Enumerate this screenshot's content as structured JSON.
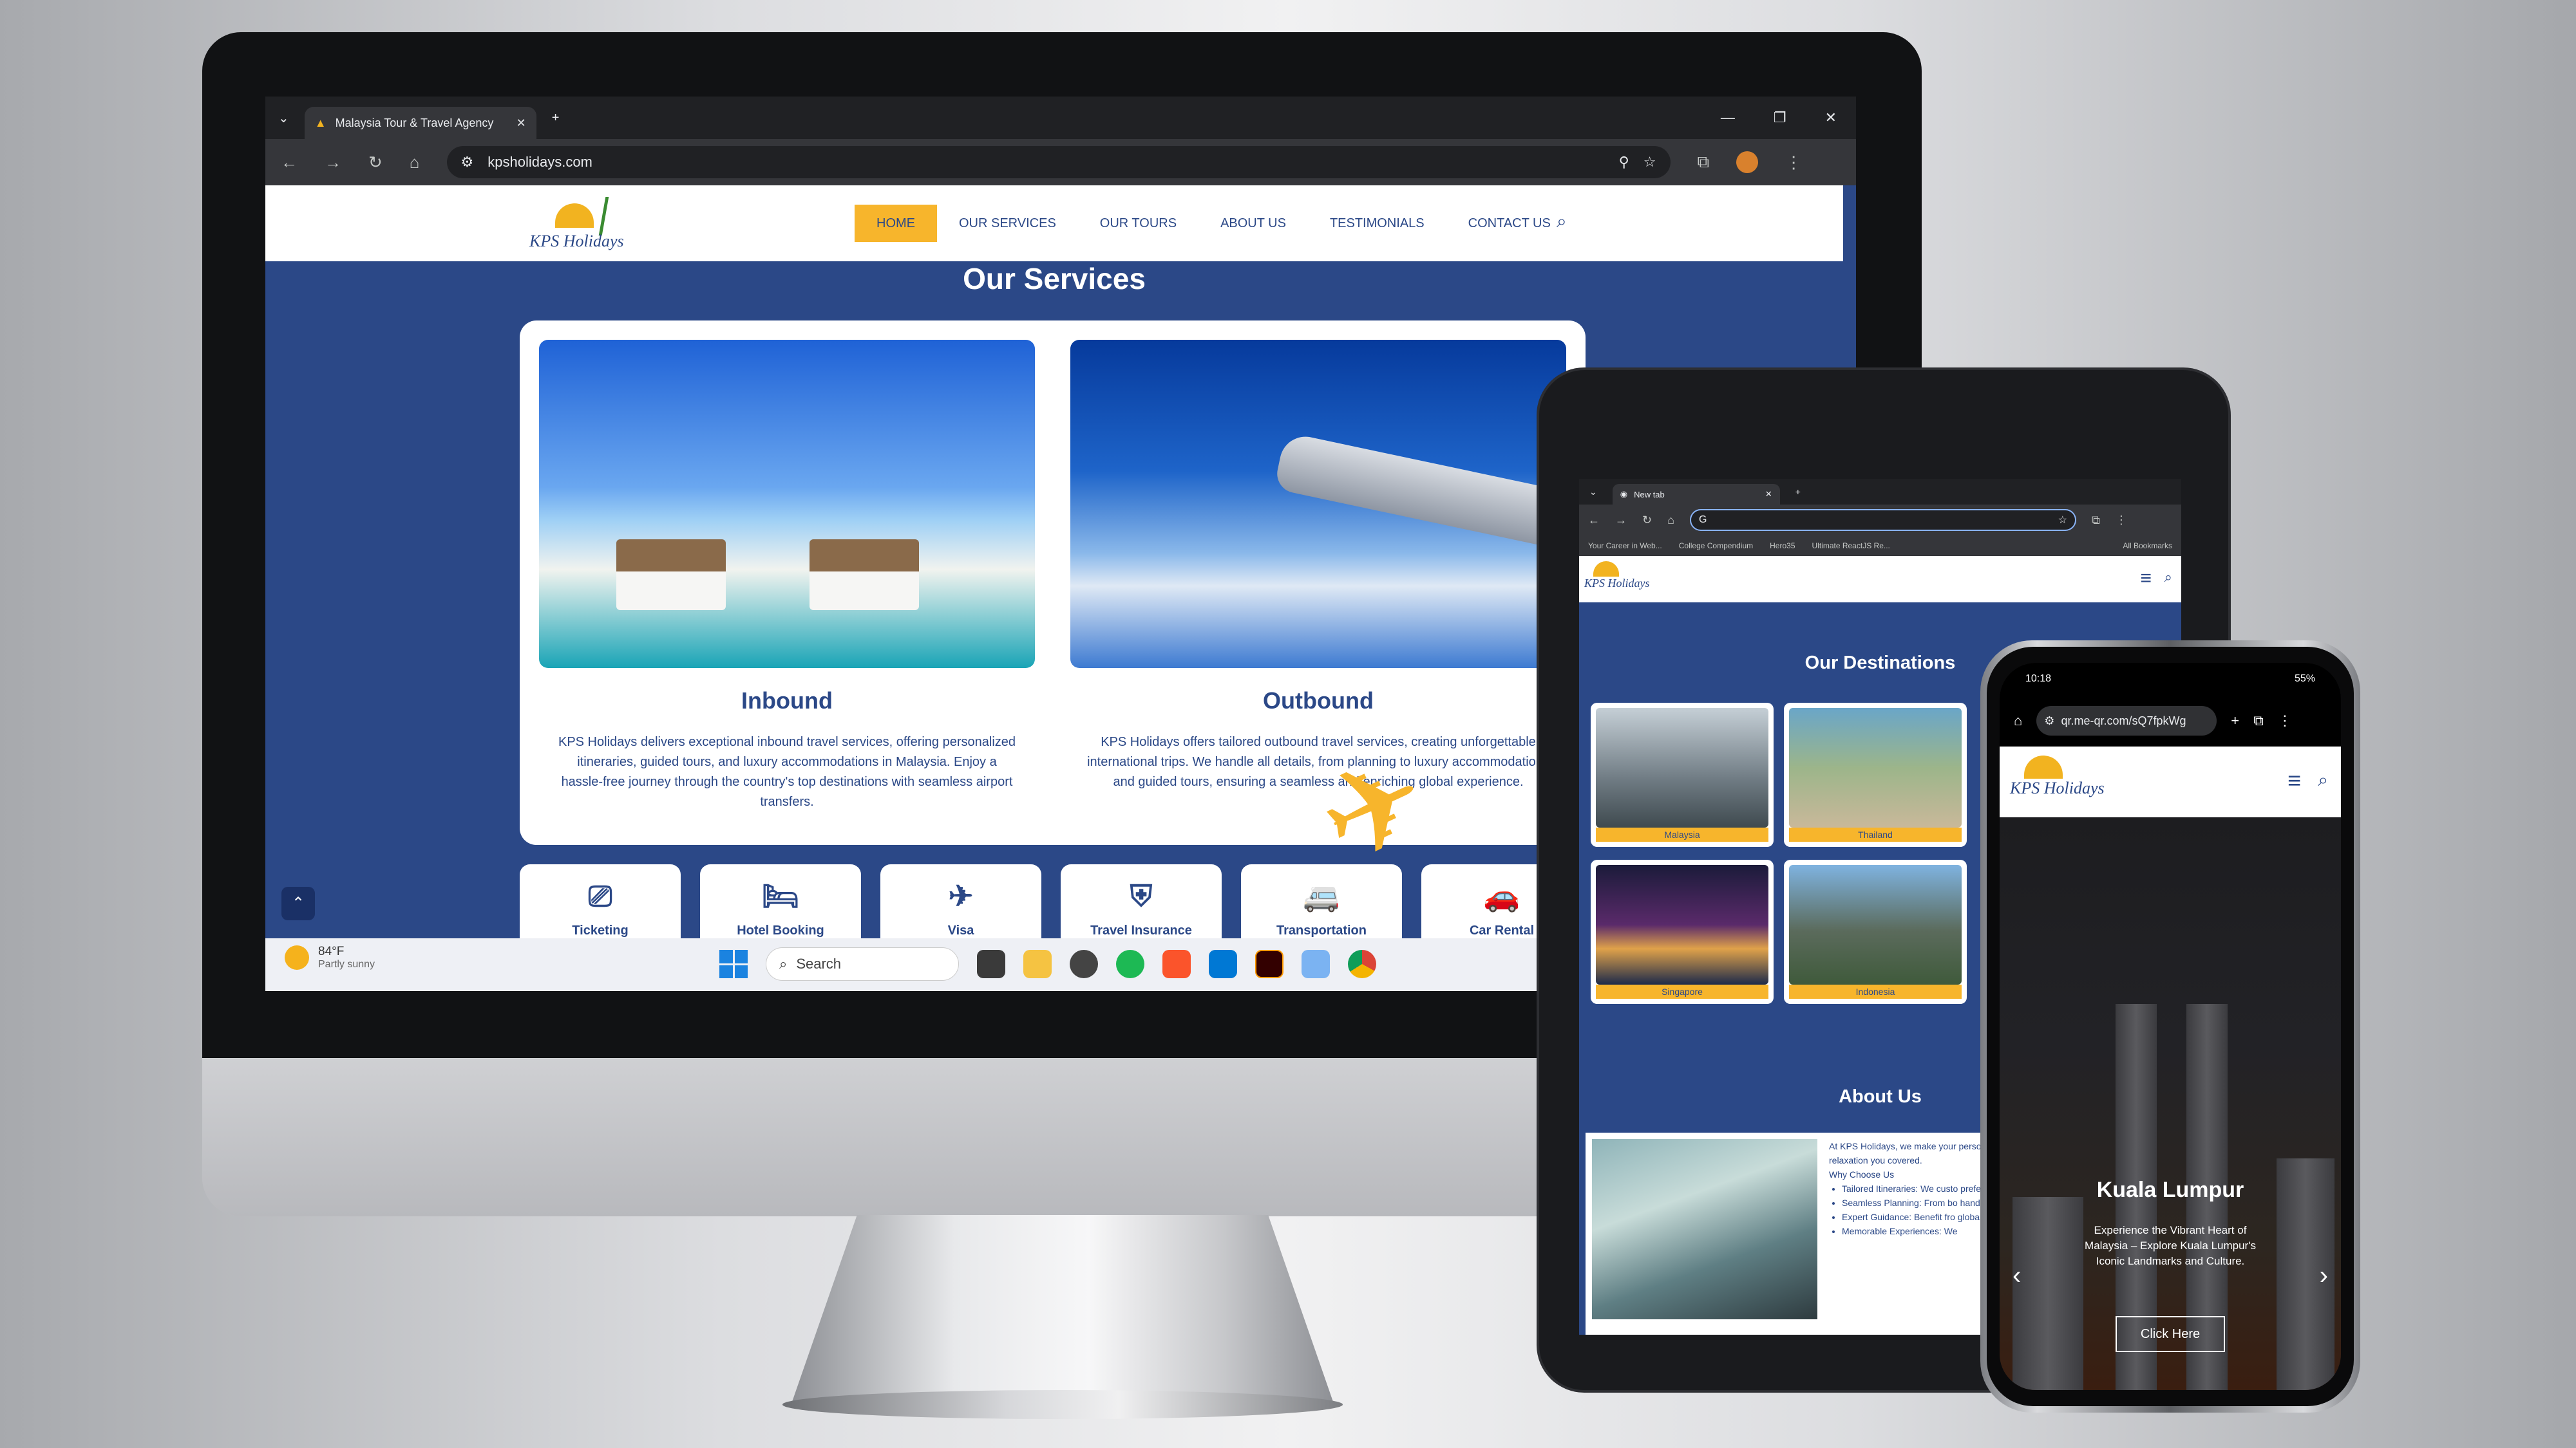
{
  "desktop": {
    "tab_title": "Malaysia Tour & Travel Agency",
    "url": "kpsholidays.com",
    "brand": "KPS Holidays",
    "menu": [
      "HOME",
      "OUR SERVICES",
      "OUR TOURS",
      "ABOUT US",
      "TESTIMONIALS",
      "CONTACT US"
    ],
    "active_menu": "HOME",
    "section_title": "Our Services",
    "services": [
      {
        "title": "Inbound",
        "desc": "KPS Holidays delivers exceptional inbound travel services, offering personalized itineraries, guided tours, and luxury accommodations in Malaysia. Enjoy a hassle-free journey through the country's top destinations with seamless airport transfers."
      },
      {
        "title": "Outbound",
        "desc": "KPS Holidays offers tailored outbound travel services, creating unforgettable international trips. We handle all details, from planning to luxury accommodations and guided tours, ensuring a seamless and enriching global experience."
      }
    ],
    "mini_services": [
      "Ticketing",
      "Hotel Booking",
      "Visa",
      "Travel Insurance",
      "Transportation",
      "Car Rental"
    ],
    "taskbar": {
      "temp": "84°F",
      "weather": "Partly sunny",
      "search": "Search"
    }
  },
  "tablet": {
    "tab_title": "New tab",
    "bookmarks": [
      "Your Career in Web...",
      "College Compendium",
      "Hero35",
      "Ultimate ReactJS Re...",
      "All Bookmarks"
    ],
    "destinations_title": "Our Destinations",
    "destinations": [
      "Malaysia",
      "Thailand",
      "Singapore",
      "Indonesia"
    ],
    "about_title": "About Us",
    "about_text": "At KPS Holidays, we make your personalized, stress-free vacation looking for adventure, relaxation you covered.",
    "why_title": "Why Choose Us",
    "why_items": [
      "Tailored Itineraries: We custo preferences.",
      "Seamless Planning: From bo handle it all.",
      "Expert Guidance: Benefit fro global destinations.",
      "Memorable Experiences: We"
    ]
  },
  "phone": {
    "time": "10:18",
    "battery": "55%",
    "url": "qr.me-qr.com/sQ7fpkWg",
    "hero_title": "Kuala Lumpur",
    "hero_desc": "Experience the Vibrant Heart of Malaysia – Explore Kuala Lumpur's Iconic Landmarks and Culture.",
    "hero_button": "Click Here"
  }
}
